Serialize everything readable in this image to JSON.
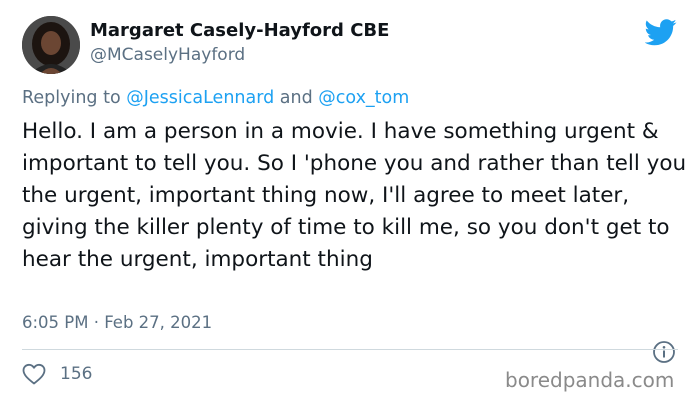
{
  "author": {
    "name": "Margaret Casely-Hayford CBE",
    "handle": "@MCaselyHayford"
  },
  "reply": {
    "prefix": "Replying to ",
    "mention_1": "@JessicaLennard",
    "joiner": " and ",
    "mention_2": "@cox_tom"
  },
  "tweet": {
    "text": "Hello. I am a person in a movie. I have something urgent & important to tell you. So I 'phone you and rather than tell you the urgent, important thing now, I'll agree to meet later, giving the killer plenty of time to kill me, so you don't get to hear the urgent, important thing",
    "timestamp": "6:05 PM · Feb 27, 2021"
  },
  "stats": {
    "likes": "156"
  },
  "watermark": "boredpanda.com",
  "icons": {
    "brand": "twitter-bird-icon",
    "info": "info-icon",
    "like": "heart-icon"
  },
  "colors": {
    "twitter_blue": "#1da1f2",
    "secondary_text": "#5b7083",
    "primary_text": "#0f1419"
  }
}
